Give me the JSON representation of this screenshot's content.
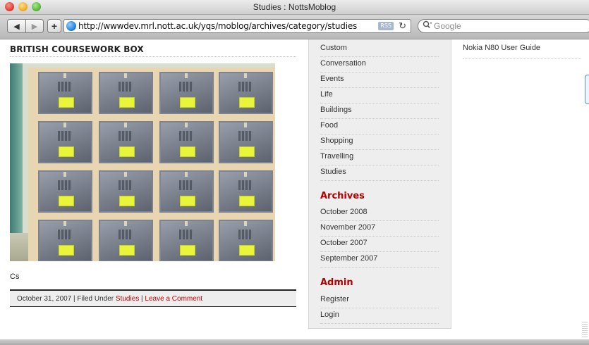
{
  "window": {
    "title": "Studies : NottsMoblog"
  },
  "toolbar": {
    "back_glyph": "◀",
    "forward_glyph": "▶",
    "add_glyph": "+",
    "url": "http://wwwdev.mrl.nott.ac.uk/yqs/moblog/archives/category/studies",
    "rss_label": "RSS",
    "reload_glyph": "↻",
    "search_placeholder": "Google"
  },
  "post": {
    "title": "BRITISH COURSEWORK BOX",
    "caption": "Cs",
    "meta_date": "October 31, 2007",
    "meta_sep1": " | Filed Under ",
    "meta_category": "Studies",
    "meta_sep2": " | ",
    "meta_comment": "Leave a Comment"
  },
  "sidebar": {
    "categories": [
      "Custom",
      "Conversation",
      "Events",
      "Life",
      "Buildings",
      "Food",
      "Shopping",
      "Travelling",
      "Studies"
    ],
    "archives_heading": "Archives",
    "archives": [
      "October 2008",
      "November 2007",
      "October 2007",
      "September 2007"
    ],
    "admin_heading": "Admin",
    "admin": [
      "Register",
      "Login"
    ]
  },
  "rightcol": {
    "links": [
      "Nokia N80 User Guide"
    ]
  },
  "colors": {
    "accent": "#b30000",
    "link": "#cc0000",
    "sidebar_bg": "#eeeeee"
  }
}
